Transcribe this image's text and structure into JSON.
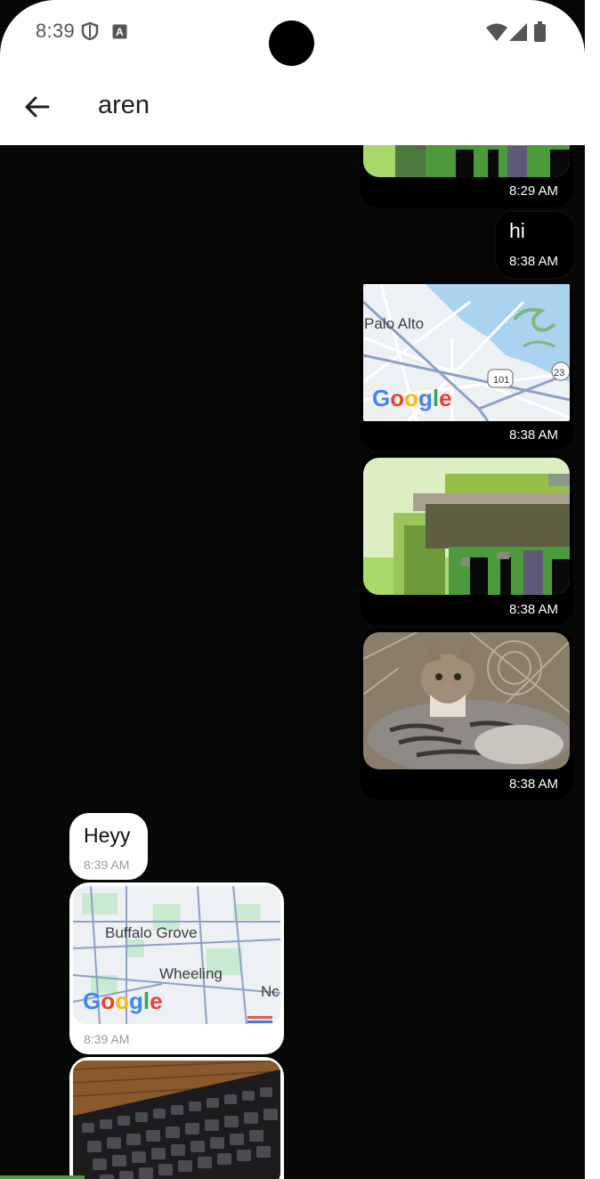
{
  "status_bar": {
    "time": "8:39",
    "icons": [
      "shield-icon",
      "keyboard-a-icon",
      "wifi-icon",
      "signal-icon",
      "battery-icon"
    ]
  },
  "header": {
    "title": "aren",
    "back_icon": "arrow-left-icon"
  },
  "colors": {
    "screen_bg": "#060806",
    "bubble_out": "#000000",
    "bubble_in": "#ffffff",
    "map_water": "#aad3f0",
    "pixel_green": "#4c9a3c"
  },
  "messages": [
    {
      "direction": "outgoing",
      "type": "image",
      "time": "8:29 AM"
    },
    {
      "direction": "outgoing",
      "type": "text",
      "text": "hi",
      "time": "8:38 AM"
    },
    {
      "direction": "outgoing",
      "type": "map",
      "labels": [
        "Palo Alto",
        "Google",
        "101",
        "23"
      ],
      "time": "8:38 AM"
    },
    {
      "direction": "outgoing",
      "type": "image",
      "time": "8:38 AM"
    },
    {
      "direction": "outgoing",
      "type": "photo",
      "subject": "cat",
      "time": "8:38 AM"
    },
    {
      "direction": "incoming",
      "type": "text",
      "text": "Heyy",
      "time": "8:39 AM"
    },
    {
      "direction": "incoming",
      "type": "map",
      "labels": [
        "Buffalo Grove",
        "Wheeling",
        "Nc",
        "Google"
      ],
      "time": "8:39 AM"
    },
    {
      "direction": "incoming",
      "type": "photo",
      "subject": "keyboard"
    }
  ]
}
